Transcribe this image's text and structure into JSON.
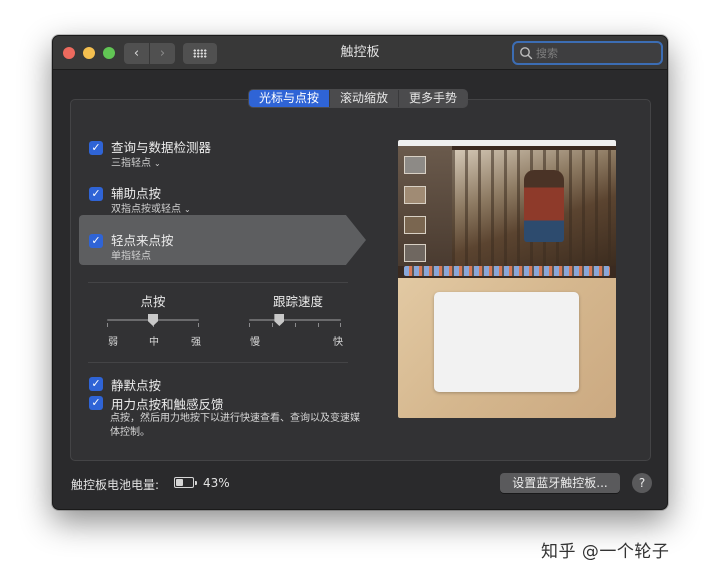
{
  "window": {
    "title": "触控板"
  },
  "toolbar": {
    "back_glyph": "‹",
    "forward_glyph": "›"
  },
  "search": {
    "placeholder": "搜索",
    "value": ""
  },
  "tabs": [
    {
      "label": "光标与点按",
      "active": true
    },
    {
      "label": "滚动缩放",
      "active": false
    },
    {
      "label": "更多手势",
      "active": false
    }
  ],
  "options": {
    "lookup": {
      "label": "查询与数据检测器",
      "sub": "三指轻点",
      "checked": true
    },
    "secondary": {
      "label": "辅助点按",
      "sub": "双指点按或轻点",
      "checked": true
    },
    "tap": {
      "label": "轻点来点按",
      "sub": "单指轻点",
      "checked": true
    },
    "silent": {
      "label": "静默点按",
      "checked": true
    },
    "force": {
      "label": "用力点按和触感反馈",
      "checked": true,
      "desc": "点按，然后用力地按下以进行快速查看、查询以及变速媒体控制。"
    }
  },
  "sliders": {
    "click": {
      "title": "点按",
      "min_label": "弱",
      "mid_label": "中",
      "max_label": "强",
      "value": 0.5
    },
    "tracking": {
      "title": "跟踪速度",
      "min_label": "慢",
      "max_label": "快",
      "value": 0.33
    }
  },
  "footer": {
    "battery_label": "触控板电池电量:",
    "battery_percent": "43%",
    "battery_level": 0.43,
    "bluetooth_button": "设置蓝牙触控板...",
    "help_button": "?"
  },
  "watermark": "知乎 @一个轮子",
  "colors": {
    "accent": "#2f64d6",
    "window_bg": "#2a2a2c",
    "titlebar": "#383838"
  },
  "icons": {
    "check": "✓",
    "chevron": "⌄"
  }
}
